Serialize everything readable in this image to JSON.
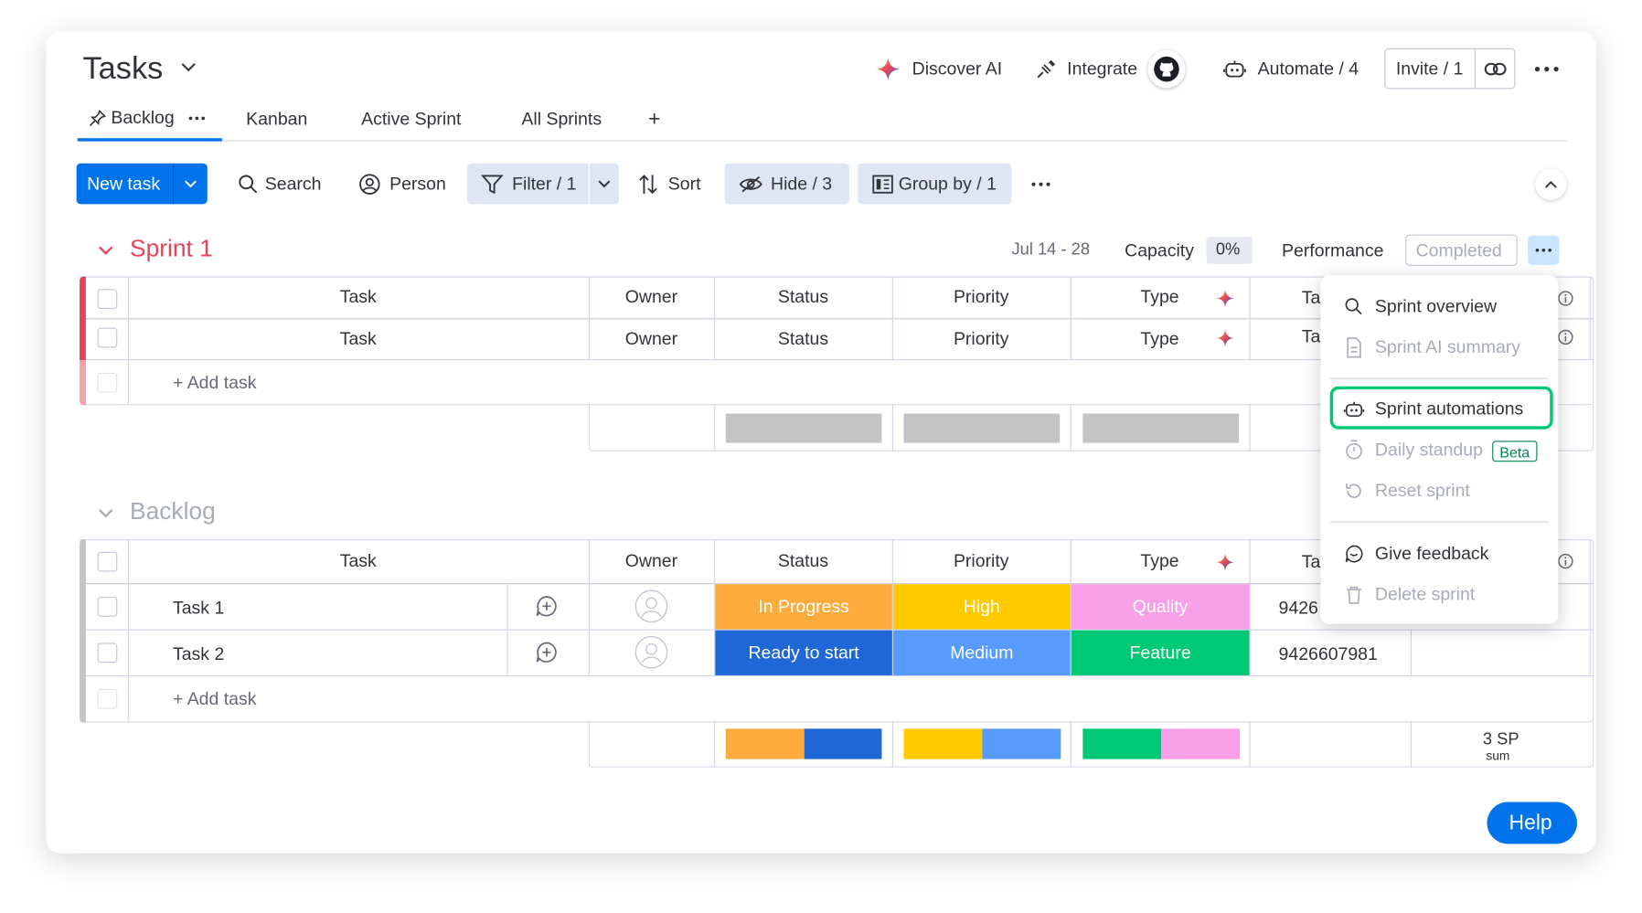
{
  "header": {
    "title": "Tasks",
    "discover_ai": "Discover AI",
    "integrate": "Integrate",
    "automate": "Automate / 4",
    "invite": "Invite / 1"
  },
  "tabs": {
    "backlog": "Backlog",
    "kanban": "Kanban",
    "active_sprint": "Active Sprint",
    "all_sprints": "All Sprints",
    "add": "+"
  },
  "toolbar": {
    "new_task": "New task",
    "search": "Search",
    "person": "Person",
    "filter": "Filter / 1",
    "sort": "Sort",
    "hide": "Hide / 3",
    "group_by": "Group by / 1"
  },
  "sprint1": {
    "name": "Sprint 1",
    "dates": "Jul 14 - 28",
    "capacity_label": "Capacity",
    "capacity_value": "0%",
    "performance_label": "Performance",
    "performance_value": "Completed",
    "columns": [
      "Task",
      "Owner",
      "Status",
      "Priority",
      "Type",
      "Ta"
    ],
    "sub_columns": [
      "Task",
      "Owner",
      "Status",
      "Priority",
      "Type",
      "Ta"
    ],
    "add_task": "+ Add task"
  },
  "backlog": {
    "name": "Backlog",
    "columns": [
      "Task",
      "Owner",
      "Status",
      "Priority",
      "Type",
      "Ta"
    ],
    "rows": [
      {
        "task": "Task 1",
        "status": "In Progress",
        "priority": "High",
        "type": "Quality",
        "id": "9426"
      },
      {
        "task": "Task 2",
        "status": "Ready to start",
        "priority": "Medium",
        "type": "Feature",
        "id": "9426607981"
      }
    ],
    "add_task": "+ Add task",
    "sum_value": "3 SP",
    "sum_label": "sum"
  },
  "menu": {
    "sprint_overview": "Sprint overview",
    "sprint_ai_summary": "Sprint AI summary",
    "sprint_automations": "Sprint automations",
    "daily_standup": "Daily standup",
    "beta": "Beta",
    "reset_sprint": "Reset sprint",
    "give_feedback": "Give feedback",
    "delete_sprint": "Delete sprint"
  },
  "help": "Help",
  "colors": {
    "primary": "#0073ea",
    "sprint_red": "#e2445c",
    "in_progress": "#fdab3d",
    "ready_to_start": "#1f67d6",
    "high": "#ffcb00",
    "medium": "#579bfc",
    "quality": "#f8a1e8",
    "feature": "#00c875",
    "menu_highlight": "#00c875"
  }
}
